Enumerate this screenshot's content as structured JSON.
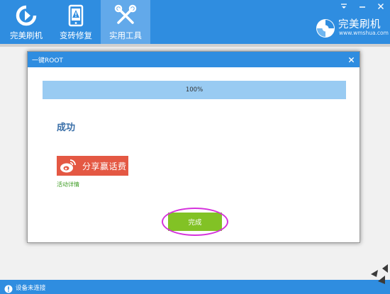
{
  "app": {
    "brand_name": "完美刷机",
    "brand_url": "www.wmshua.com",
    "accent": "#2f8de0",
    "active_tab_color": "#62a9ea"
  },
  "nav": {
    "tabs": [
      {
        "label": "完美刷机",
        "icon": "refresh-arrow-icon",
        "active": false
      },
      {
        "label": "变砖修复",
        "icon": "phone-warning-icon",
        "active": false
      },
      {
        "label": "实用工具",
        "icon": "tools-icon",
        "active": true
      }
    ]
  },
  "window_controls": [
    "minimize-dropdown-icon",
    "minimize-icon",
    "close-icon"
  ],
  "dialog": {
    "title": "一键ROOT",
    "progress_text": "100%",
    "progress_value": 1.0,
    "progress_color": "#99cbf2",
    "result": "成功",
    "share_label": "分享赢话费",
    "share_color": "#e45843",
    "event_link": "活动详情",
    "done_label": "完成",
    "done_color": "#82c225",
    "highlight_color": "#d531dc"
  },
  "status": {
    "text": "设备未连接",
    "icon": "alert-circle-icon"
  }
}
